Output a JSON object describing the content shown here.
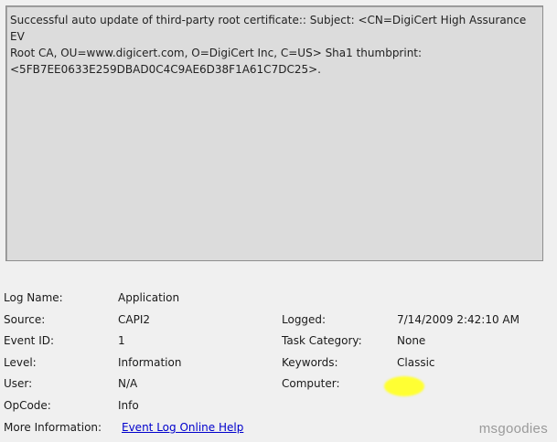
{
  "description": "Successful auto update of third-party root certificate:: Subject: <CN=DigiCert High Assurance EV\nRoot CA, OU=www.digicert.com, O=DigiCert Inc, C=US> Sha1 thumbprint:\n<5FB7EE0633E259DBAD0C4C9AE6D38F1A61C7DC25>.",
  "fields": {
    "log_name_label": "Log Name:",
    "log_name_value": "Application",
    "source_label": "Source:",
    "source_value": "CAPI2",
    "logged_label": "Logged:",
    "logged_value": "7/14/2009 2:42:10 AM",
    "event_id_label": "Event ID:",
    "event_id_value": "1",
    "task_category_label": "Task Category:",
    "task_category_value": "None",
    "level_label": "Level:",
    "level_value": "Information",
    "keywords_label": "Keywords:",
    "keywords_value": "Classic",
    "user_label": "User:",
    "user_value": "N/A",
    "computer_label": "Computer:",
    "opcode_label": "OpCode:",
    "opcode_value": "Info",
    "more_info_label": "More Information:",
    "more_info_link": "Event Log Online Help"
  },
  "watermark": "msgoodies",
  "colors": {
    "highlight": "#ffff33",
    "link": "#0000cc"
  }
}
